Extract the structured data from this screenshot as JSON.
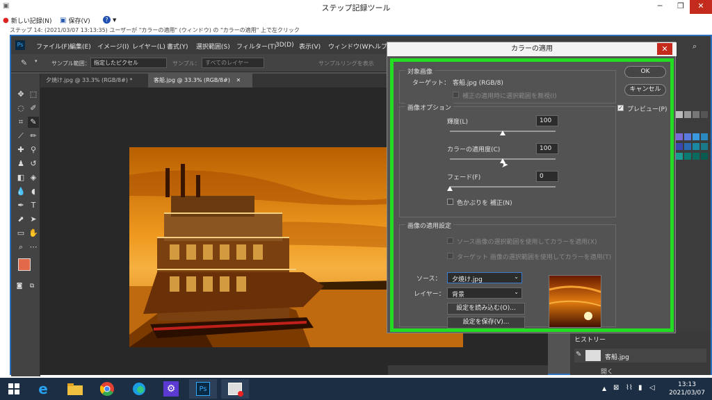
{
  "recorder": {
    "title": "ステップ記録ツール",
    "record": "新しい記録(N)",
    "save": "保存(V)",
    "step_text": "ステップ 14: (2021/03/07 13:13:35) ユーザーが \"カラーの適用\" (ウィンドウ) の \"カラーの適用\" 上で左クリック"
  },
  "ps": {
    "menu": [
      "ファイル(F)",
      "編集(E)",
      "イメージ(I)",
      "レイヤー(L)",
      "書式(Y)",
      "選択範囲(S)",
      "フィルター(T)",
      "3D(D)",
      "表示(V)",
      "ウィンドウ(W)",
      "ヘルプ"
    ],
    "options": {
      "sample_label": "サンプル範囲：",
      "sample_value": "指定したピクセル",
      "sample2_label": "サンプル：",
      "sample2_value": "すべてのレイヤー",
      "ring": "サンプルリングを表示"
    },
    "tabs": [
      "夕焼け.jpg @ 33.3% (RGB/8#) *",
      "客船.jpg @ 33.3% (RGB/8#)"
    ],
    "history_label": "ヒストリー",
    "history_item": "客船.jpg",
    "history_item2": "開く"
  },
  "dialog": {
    "title": "カラーの適用",
    "target_group": "対象画像",
    "target_label": "ターゲット：",
    "target_value": "客船.jpg (RGB/8)",
    "ignore_sel": "補正の適用時に選択範囲を無視(I)",
    "options_group": "画像オプション",
    "lum_label": "輝度(L)",
    "lum_value": "100",
    "lum_pct": 0.5,
    "intensity_label": "カラーの適用度(C)",
    "intensity_value": "100",
    "intensity_pct": 0.5,
    "fade_label": "フェード(F)",
    "fade_value": "0",
    "fade_pct": 0.0,
    "neutralize": "色かぶりを 補正(N)",
    "stats_group": "画像の適用設定",
    "use_source_sel": "ソース画像の選択範囲を使用してカラーを適用(X)",
    "use_target_sel": "ターゲット 画像の選択範囲を使用してカラーを適用(T)",
    "source_label": "ソース：",
    "source_value": "夕焼け.jpg",
    "layer_label": "レイヤー：",
    "layer_value": "背景",
    "load_btn": "設定を読み込む(O)...",
    "save_btn": "設定を保存(V)...",
    "ok": "OK",
    "cancel": "キャンセル",
    "preview": "プレビュー(P)"
  },
  "taskbar": {
    "time": "13:13",
    "date": "2021/03/07"
  }
}
